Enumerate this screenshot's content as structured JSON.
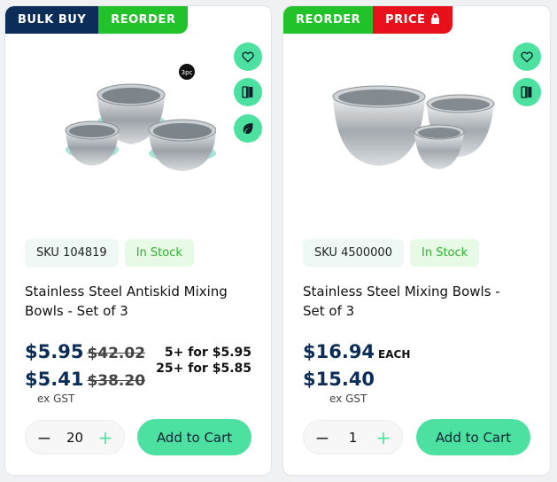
{
  "products": [
    {
      "badges": [
        "BULK BUY",
        "REORDER"
      ],
      "sku": "SKU 104819",
      "stock": "In Stock",
      "title": "Stainless Steel Antiskid Mixing Bowls - Set of 3",
      "image_tag": "3pc",
      "price_main": "$5.95",
      "price_main_old": "$42.02",
      "price_second": "$5.41",
      "price_second_old": "$38.20",
      "ex_gst": "ex GST",
      "bulk_tiers": [
        "5+ for $5.95",
        "25+ for $5.85"
      ],
      "quantity": "20",
      "add_label": "Add to Cart",
      "actions": [
        "heart-icon",
        "compare-icon",
        "leaf-icon"
      ]
    },
    {
      "badges": [
        "REORDER",
        "PRICE"
      ],
      "sku": "SKU 4500000",
      "stock": "In Stock",
      "title": "Stainless Steel Mixing Bowls - Set of 3",
      "price_main": "$16.94",
      "price_unit": "EACH",
      "price_second": "$15.40",
      "ex_gst": "ex GST",
      "quantity": "1",
      "add_label": "Add to Cart",
      "actions": [
        "heart-icon",
        "compare-icon"
      ]
    }
  ],
  "colors": {
    "navy": "#0c2d57",
    "green_badge": "#22c32a",
    "red_badge": "#e8101b",
    "accent": "#4de1a1",
    "stock_text": "#2fb22e"
  }
}
